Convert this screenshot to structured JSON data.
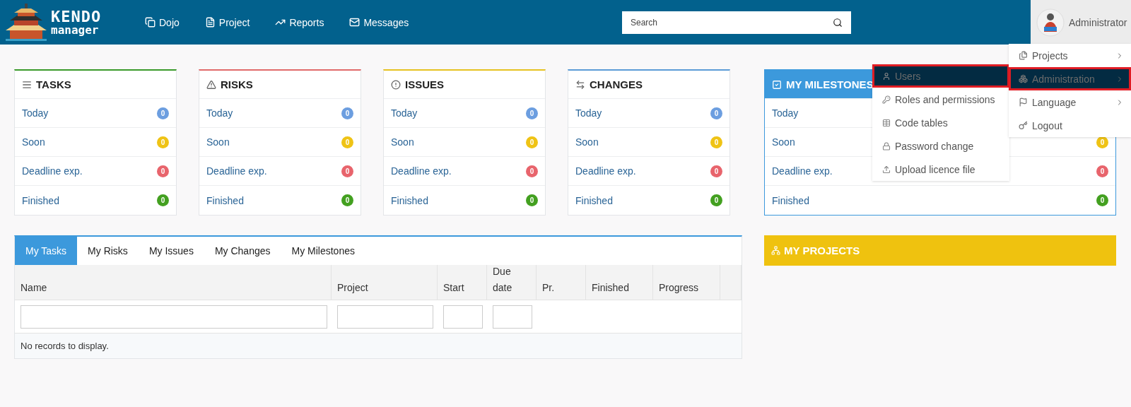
{
  "header": {
    "logo": {
      "line1": "KENDO",
      "line2": "manager"
    },
    "nav": [
      {
        "label": "Dojo"
      },
      {
        "label": "Project"
      },
      {
        "label": "Reports"
      },
      {
        "label": "Messages"
      }
    ],
    "search": {
      "placeholder": "Search"
    },
    "user": {
      "name": "Administrator"
    }
  },
  "summary_cards": [
    {
      "title": "TASKS",
      "kind": "plain",
      "color": "#3a9a2a",
      "rows": [
        {
          "label": "Today",
          "count": "0",
          "color": "#6c9ee0"
        },
        {
          "label": "Soon",
          "count": "0",
          "color": "#efc315"
        },
        {
          "label": "Deadline exp.",
          "count": "0",
          "color": "#e8646c"
        },
        {
          "label": "Finished",
          "count": "0",
          "color": "#43a020"
        }
      ]
    },
    {
      "title": "RISKS",
      "kind": "plain",
      "color": "#e06a6a",
      "rows": [
        {
          "label": "Today",
          "count": "0",
          "color": "#6c9ee0"
        },
        {
          "label": "Soon",
          "count": "0",
          "color": "#efc315"
        },
        {
          "label": "Deadline exp.",
          "count": "0",
          "color": "#e8646c"
        },
        {
          "label": "Finished",
          "count": "0",
          "color": "#43a020"
        }
      ]
    },
    {
      "title": "ISSUES",
      "kind": "plain",
      "color": "#e6c220",
      "rows": [
        {
          "label": "Today",
          "count": "0",
          "color": "#6c9ee0"
        },
        {
          "label": "Soon",
          "count": "0",
          "color": "#efc315"
        },
        {
          "label": "Deadline exp.",
          "count": "0",
          "color": "#e8646c"
        },
        {
          "label": "Finished",
          "count": "0",
          "color": "#43a020"
        }
      ]
    },
    {
      "title": "CHANGES",
      "kind": "plain",
      "color": "#5b9bd6",
      "rows": [
        {
          "label": "Today",
          "count": "0",
          "color": "#6c9ee0"
        },
        {
          "label": "Soon",
          "count": "0",
          "color": "#efc315"
        },
        {
          "label": "Deadline exp.",
          "count": "0",
          "color": "#e8646c"
        },
        {
          "label": "Finished",
          "count": "0",
          "color": "#43a020"
        }
      ]
    }
  ],
  "milestones_card": {
    "title": "MY MILESTONES",
    "kind": "filled",
    "color": "#3c99dc",
    "rows": [
      {
        "label": "Today"
      },
      {
        "label": "Soon",
        "count": "0",
        "color": "#efc315"
      },
      {
        "label": "Deadline exp.",
        "count": "0",
        "color": "#e8646c"
      },
      {
        "label": "Finished",
        "count": "0",
        "color": "#43a020"
      }
    ]
  },
  "task_table": {
    "tabs": [
      {
        "label": "My Tasks",
        "selected": true
      },
      {
        "label": "My Risks",
        "selected": false
      },
      {
        "label": "My Issues",
        "selected": false
      },
      {
        "label": "My Changes",
        "selected": false
      },
      {
        "label": "My Milestones",
        "selected": false
      }
    ],
    "columns": [
      {
        "label": "Name",
        "filter": true
      },
      {
        "label": "Project",
        "filter": true
      },
      {
        "label": "Start",
        "filter": true
      },
      {
        "label": "Due date",
        "filter": true
      },
      {
        "label": "Pr.",
        "filter": false
      },
      {
        "label": "Finished",
        "filter": false
      },
      {
        "label": "Progress",
        "filter": false
      }
    ],
    "empty_message": "No records to display."
  },
  "projects_panel": {
    "title": "MY PROJECTS"
  },
  "user_menu": {
    "items": [
      {
        "label": "Projects",
        "submenu": true,
        "highlighted": false
      },
      {
        "label": "Administration",
        "submenu": true,
        "highlighted": true
      },
      {
        "label": "Language",
        "submenu": true,
        "highlighted": false
      },
      {
        "label": "Logout",
        "submenu": false,
        "highlighted": false
      }
    ]
  },
  "admin_submenu": {
    "items": [
      {
        "label": "Users",
        "highlighted": true
      },
      {
        "label": "Roles and permissions",
        "highlighted": false
      },
      {
        "label": "Code tables",
        "highlighted": false
      },
      {
        "label": "Password change",
        "highlighted": false
      },
      {
        "label": "Upload licence file",
        "highlighted": false
      }
    ]
  }
}
